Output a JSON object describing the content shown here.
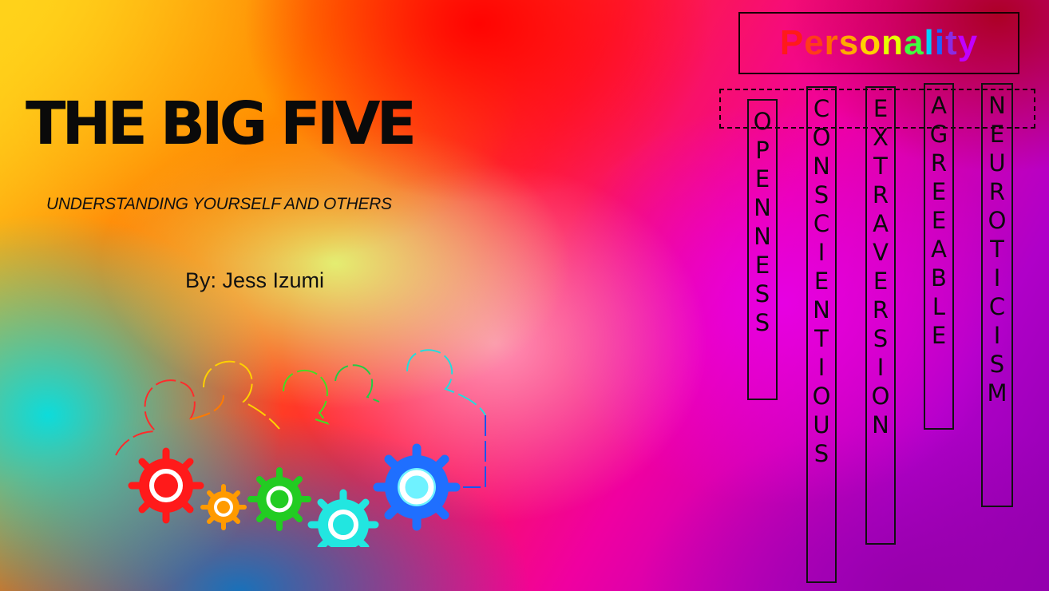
{
  "slide": {
    "title": "THE BIG FIVE",
    "subtitle": "UNDERSTANDING YOURSELF AND OTHERS",
    "author": "By: Jess Izumi"
  },
  "personality": {
    "heading": "Personality",
    "heading_letter_colors": [
      "#ff1a1a",
      "#ff3b1a",
      "#ff6a00",
      "#ffaa00",
      "#ffd000",
      "#e6ff00",
      "#40ff40",
      "#00d0ff",
      "#2060ff",
      "#8a2be2",
      "#c000ff"
    ],
    "traits": [
      "OPENNESS",
      "CONSCIENTIOUS",
      "EXTRAVERSION",
      "AGREEABLE",
      "NEUROTICISM"
    ]
  },
  "graphic": {
    "icon": "people-with-gears-icon",
    "colors": [
      "#ff2020",
      "#ff9900",
      "#33cc33",
      "#22dddd",
      "#1a6fff"
    ]
  }
}
